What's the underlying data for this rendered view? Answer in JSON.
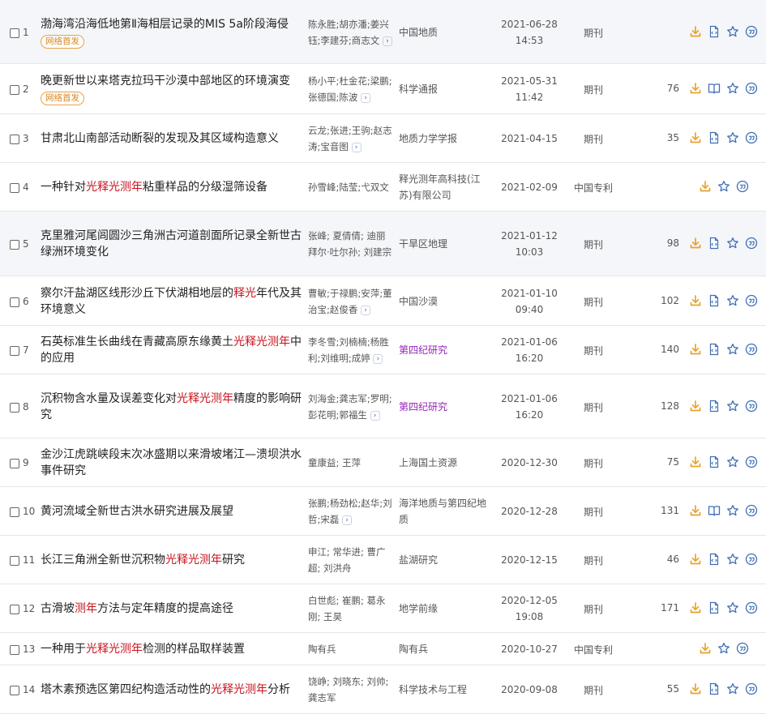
{
  "colors": {
    "highlight": "#c8141e",
    "badge": "#d7861f",
    "icon_orange": "#e8a22c",
    "icon_blue": "#3f6fb5",
    "journal_purple": "#9424b8",
    "row_alt_bg": "#f4f6f9"
  },
  "icons": {
    "download": "download-icon",
    "html": "html-reading-icon",
    "read": "open-book-icon",
    "collect": "star-icon",
    "cite": "quote-icon",
    "more": "chevron-right-icon"
  },
  "rows": [
    {
      "num": "1",
      "title": [
        {
          "t": "渤海湾沿海低地第Ⅱ海相层记录的MIS 5a阶段海侵"
        }
      ],
      "badge": "网络首发",
      "authors": "陈永胜;胡亦潘;姜兴钰;李建芬;商志文",
      "more": "›",
      "source": "中国地质",
      "date": "2021-06-28",
      "time": "14:53",
      "type": "期刊",
      "count": "",
      "icons": [
        "download",
        "html",
        "collect",
        "cite"
      ]
    },
    {
      "num": "2",
      "title": [
        {
          "t": "晚更新世以来塔克拉玛干沙漠中部地区的环境演变"
        }
      ],
      "badge": "网络首发",
      "authors": "杨小平;杜金花;梁鹏;张德国;陈波",
      "more": "›",
      "source": "科学通报",
      "date": "2021-05-31",
      "time": "11:42",
      "type": "期刊",
      "count": "76",
      "icons": [
        "download",
        "read",
        "collect",
        "cite"
      ]
    },
    {
      "num": "3",
      "title": [
        {
          "t": "甘肃北山南部活动断裂的发现及其区域构造意义"
        }
      ],
      "badge": "",
      "authors": "云龙;张进;王驹;赵志涛;宝音图",
      "more": "›",
      "source": "地质力学学报",
      "date": "2021-04-15",
      "time": "",
      "type": "期刊",
      "count": "35",
      "icons": [
        "download",
        "html",
        "collect",
        "cite"
      ]
    },
    {
      "num": "4",
      "title": [
        {
          "t": "一种针对"
        },
        {
          "t": "光释光测年",
          "h": true
        },
        {
          "t": "粘重样品的分级湿筛设备"
        }
      ],
      "badge": "",
      "authors": "孙雪峰;陆莹;弋双文",
      "more": "",
      "source": "释光测年高科技(江苏)有限公司",
      "date": "2021-02-09",
      "time": "",
      "type": "中国专利",
      "count": "",
      "icons": [
        "download",
        "collect",
        "cite"
      ]
    },
    {
      "num": "5",
      "title": [
        {
          "t": "克里雅河尾闾圆沙三角洲古河道剖面所记录全新世古绿洲环境变化"
        }
      ],
      "badge": "",
      "authors": "张峰; 夏倩倩; 迪丽拜尔·吐尔孙; 刘建宗",
      "more": "",
      "source": "干旱区地理",
      "date": "2021-01-12",
      "time": "10:03",
      "type": "期刊",
      "count": "98",
      "icons": [
        "download",
        "html",
        "collect",
        "cite"
      ]
    },
    {
      "num": "6",
      "title": [
        {
          "t": "察尔汗盐湖区线形沙丘下伏湖相地层的"
        },
        {
          "t": "释光",
          "h": true
        },
        {
          "t": "年代及其环境意义"
        }
      ],
      "badge": "",
      "authors": "曹敏;于禄鹏;安萍;董治宝;赵俊香",
      "more": "›",
      "source": "中国沙漠",
      "date": "2021-01-10",
      "time": "09:40",
      "type": "期刊",
      "count": "102",
      "icons": [
        "download",
        "html",
        "collect",
        "cite"
      ]
    },
    {
      "num": "7",
      "title": [
        {
          "t": "石英标准生长曲线在青藏高原东缘黄土"
        },
        {
          "t": "光释光测年",
          "h": true
        },
        {
          "t": "中的应用"
        }
      ],
      "badge": "",
      "authors": "李冬雪;刘楠楠;杨胜利;刘维明;成婷",
      "more": "›",
      "source": "第四纪研究",
      "purple": true,
      "date": "2021-01-06",
      "time": "16:20",
      "type": "期刊",
      "count": "140",
      "icons": [
        "download",
        "html",
        "collect",
        "cite"
      ]
    },
    {
      "num": "8",
      "title": [
        {
          "t": "沉积物含水量及误差变化对"
        },
        {
          "t": "光释光测年",
          "h": true
        },
        {
          "t": "精度的影响研究"
        }
      ],
      "badge": "",
      "authors": "刘海金;龚志军;罗明;彭花明;郭福生",
      "more": "›",
      "source": "第四纪研究",
      "purple": true,
      "date": "2021-01-06",
      "time": "16:20",
      "type": "期刊",
      "count": "128",
      "icons": [
        "download",
        "html",
        "collect",
        "cite"
      ]
    },
    {
      "num": "9",
      "title": [
        {
          "t": "金沙江虎跳峡段末次冰盛期以来滑坡堵江—溃坝洪水事件研究"
        }
      ],
      "badge": "",
      "authors": "童康益; 王萍",
      "more": "",
      "source": "上海国土资源",
      "date": "2020-12-30",
      "time": "",
      "type": "期刊",
      "count": "75",
      "icons": [
        "download",
        "html",
        "collect",
        "cite"
      ]
    },
    {
      "num": "10",
      "title": [
        {
          "t": "黄河流域全新世古洪水研究进展及展望"
        }
      ],
      "badge": "",
      "authors": "张鹏;杨劲松;赵华;刘哲;宋磊",
      "more": "›",
      "source": "海洋地质与第四纪地质",
      "date": "2020-12-28",
      "time": "",
      "type": "期刊",
      "count": "131",
      "icons": [
        "download",
        "read",
        "collect",
        "cite"
      ]
    },
    {
      "num": "11",
      "title": [
        {
          "t": "长江三角洲全新世沉积物"
        },
        {
          "t": "光释光测年",
          "h": true
        },
        {
          "t": "研究"
        }
      ],
      "badge": "",
      "authors": "申江; 常华进; 曹广超; 刘洪舟",
      "more": "",
      "source": "盐湖研究",
      "date": "2020-12-15",
      "time": "",
      "type": "期刊",
      "count": "46",
      "icons": [
        "download",
        "html",
        "collect",
        "cite"
      ]
    },
    {
      "num": "12",
      "title": [
        {
          "t": "古滑坡"
        },
        {
          "t": "测年",
          "h": true
        },
        {
          "t": "方法与定年精度的提高途径"
        }
      ],
      "badge": "",
      "authors": "白世彪; 崔鹏; 葛永刚; 王昊",
      "more": "",
      "source": "地学前缘",
      "date": "2020-12-05",
      "time": "19:08",
      "type": "期刊",
      "count": "171",
      "icons": [
        "download",
        "html",
        "collect",
        "cite"
      ]
    },
    {
      "num": "13",
      "title": [
        {
          "t": "一种用于"
        },
        {
          "t": "光释光测年",
          "h": true
        },
        {
          "t": "检测的样品取样装置"
        }
      ],
      "badge": "",
      "authors": "陶有兵",
      "more": "",
      "source": "陶有兵",
      "date": "2020-10-27",
      "time": "",
      "type": "中国专利",
      "count": "",
      "icons": [
        "download",
        "collect",
        "cite"
      ]
    },
    {
      "num": "14",
      "title": [
        {
          "t": "塔木素预选区第四纪构造活动性的"
        },
        {
          "t": "光释光测年",
          "h": true
        },
        {
          "t": "分析"
        }
      ],
      "badge": "",
      "authors": "饶峥; 刘晓东; 刘帅; 龚志军",
      "more": "",
      "source": "科学技术与工程",
      "date": "2020-09-08",
      "time": "",
      "type": "期刊",
      "count": "55",
      "icons": [
        "download",
        "html",
        "collect",
        "cite"
      ]
    }
  ]
}
